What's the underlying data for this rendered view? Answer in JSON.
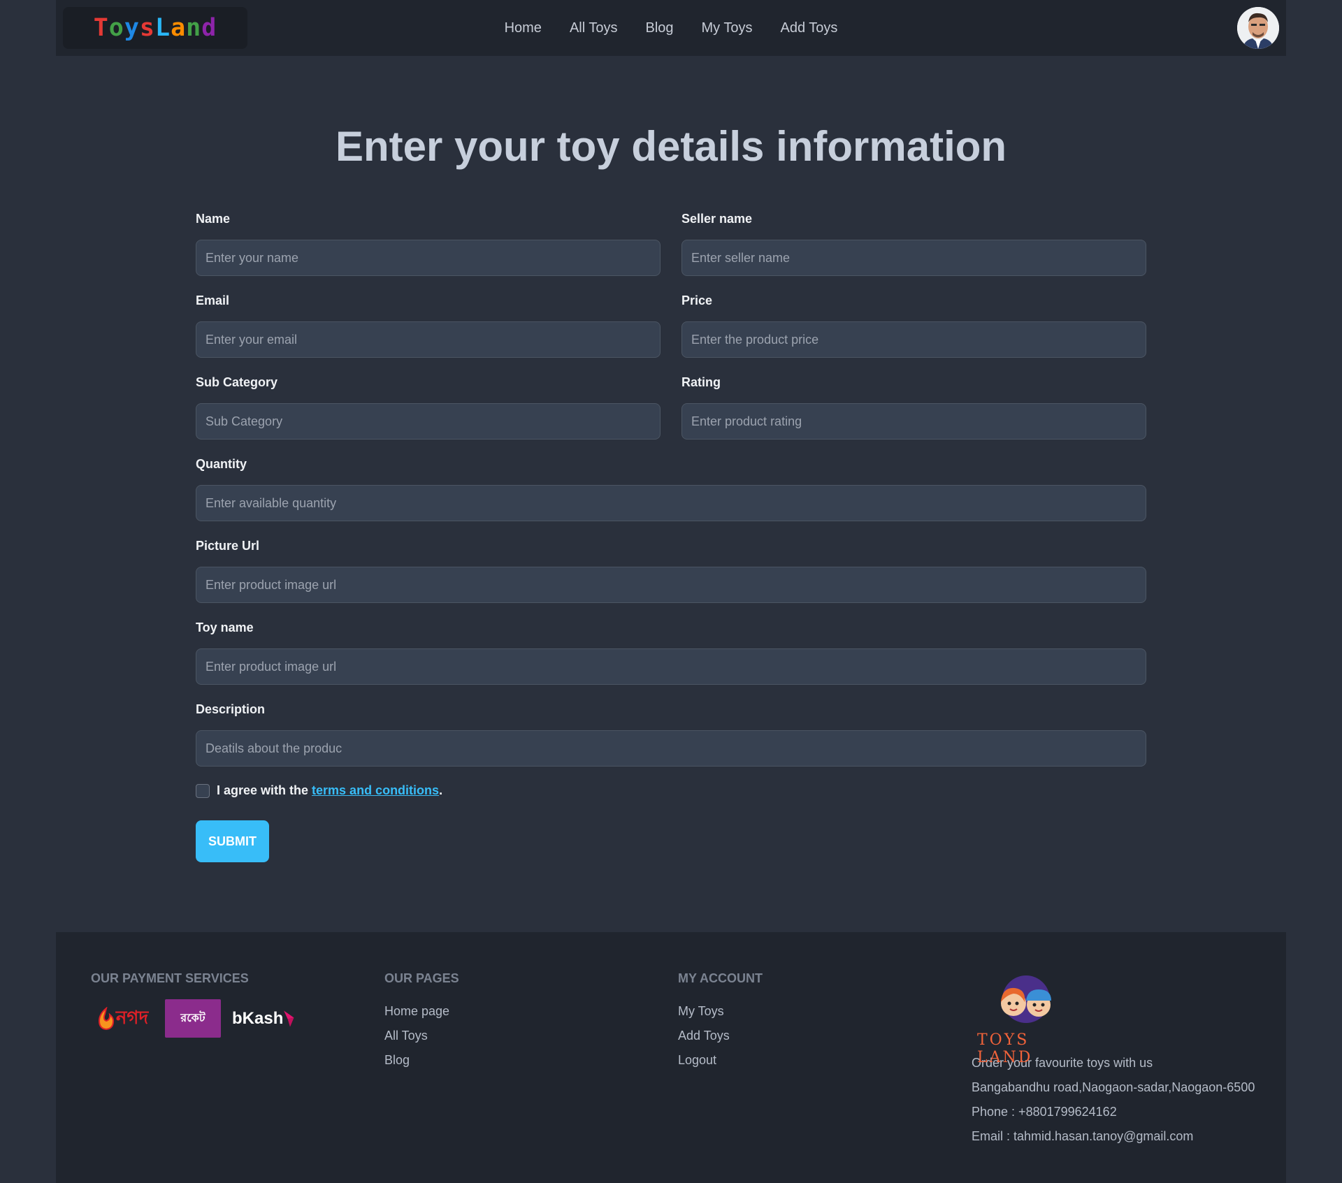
{
  "nav": {
    "logo_letters": [
      {
        "ch": "T",
        "color": "#e53935"
      },
      {
        "ch": "o",
        "color": "#43a047"
      },
      {
        "ch": "y",
        "color": "#1e88e5"
      },
      {
        "ch": "s",
        "color": "#e53935"
      },
      {
        "ch": "L",
        "color": "#29b6f6"
      },
      {
        "ch": "a",
        "color": "#fb8c00"
      },
      {
        "ch": "n",
        "color": "#43a047"
      },
      {
        "ch": "d",
        "color": "#8e24aa"
      }
    ],
    "links": [
      "Home",
      "All Toys",
      "Blog",
      "My Toys",
      "Add Toys"
    ]
  },
  "form": {
    "title": "Enter your toy details information",
    "fields": {
      "name": {
        "label": "Name",
        "placeholder": "Enter your name"
      },
      "seller": {
        "label": "Seller name",
        "placeholder": "Enter seller name"
      },
      "email": {
        "label": "Email",
        "placeholder": "Enter your email"
      },
      "price": {
        "label": "Price",
        "placeholder": "Enter the product price"
      },
      "subcategory": {
        "label": "Sub Category",
        "placeholder": "Sub Category"
      },
      "rating": {
        "label": "Rating",
        "placeholder": "Enter product rating"
      },
      "quantity": {
        "label": "Quantity",
        "placeholder": "Enter available quantity"
      },
      "picture": {
        "label": "Picture Url",
        "placeholder": "Enter product image url"
      },
      "toyname": {
        "label": "Toy name",
        "placeholder": "Enter product image url"
      },
      "description": {
        "label": "Description",
        "placeholder": "Deatils about the produc"
      }
    },
    "agree_text": "I agree with the",
    "terms_link": "terms and conditions",
    "period": ".",
    "submit_label": "SUBMIT"
  },
  "footer": {
    "payment": {
      "heading": "OUR PAYMENT SERVICES",
      "logos": [
        "নগদ",
        "রকেট",
        "bKash"
      ]
    },
    "pages": {
      "heading": "OUR PAGES",
      "links": [
        "Home page",
        "All Toys",
        "Blog"
      ]
    },
    "account": {
      "heading": "MY ACCOUNT",
      "links": [
        "My Toys",
        "Add Toys",
        "Logout"
      ]
    },
    "brand": {
      "logo_text": "TOYS LAND",
      "tagline": "Order your favourite toys with us",
      "address": "Bangabandhu road,Naogaon-sadar,Naogaon-6500",
      "phone": "Phone : +8801799624162",
      "email": "Email : tahmid.hasan.tanoy@gmail.com"
    }
  }
}
